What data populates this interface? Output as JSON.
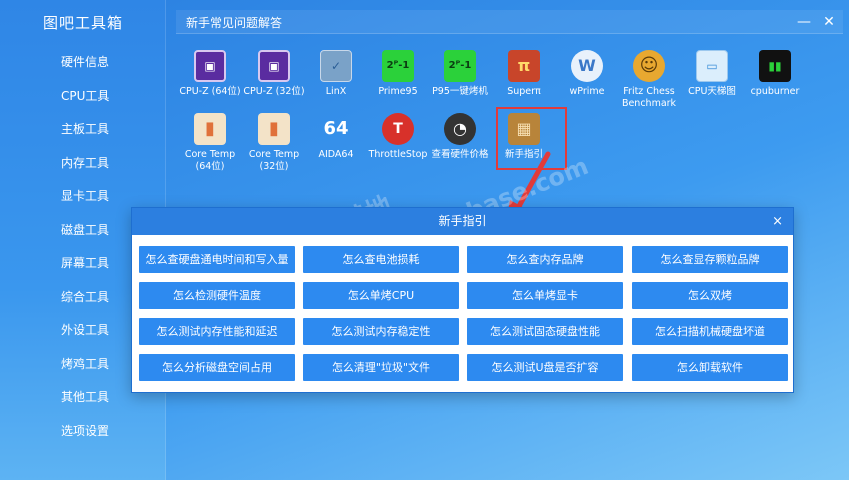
{
  "app": {
    "title": "图吧工具箱"
  },
  "sidebar": {
    "items": [
      {
        "label": "硬件信息"
      },
      {
        "label": "CPU工具"
      },
      {
        "label": "主板工具"
      },
      {
        "label": "内存工具"
      },
      {
        "label": "显卡工具"
      },
      {
        "label": "磁盘工具"
      },
      {
        "label": "屏幕工具"
      },
      {
        "label": "综合工具"
      },
      {
        "label": "外设工具"
      },
      {
        "label": "烤鸡工具"
      },
      {
        "label": "其他工具"
      },
      {
        "label": "选项设置"
      }
    ]
  },
  "topbar": {
    "title": "新手常见问题解答",
    "minimize": "—",
    "close": "✕"
  },
  "tools": [
    {
      "label": "CPU-Z (64位)",
      "icon": "cpu-z-icon",
      "glyph": "▣",
      "color": "#5a2ca0"
    },
    {
      "label": "CPU-Z (32位)",
      "icon": "cpu-z-icon",
      "glyph": "▣",
      "color": "#5a2ca0"
    },
    {
      "label": "LinX",
      "icon": "checkbox-icon",
      "glyph": "✓",
      "color": "#7aa2c8"
    },
    {
      "label": "Prime95",
      "icon": "prime95-icon",
      "glyph": "2ᴾ-1",
      "color": "#2bd13a"
    },
    {
      "label": "P95一键烤机",
      "icon": "prime95-icon",
      "glyph": "2ᴾ-1",
      "color": "#2bd13a"
    },
    {
      "label": "Superπ",
      "icon": "superpi-icon",
      "glyph": "π",
      "color": "#c8452a"
    },
    {
      "label": "wPrime",
      "icon": "wprime-icon",
      "glyph": "W",
      "color": "#3b78c8"
    },
    {
      "label": "Fritz Chess Benchmark",
      "icon": "fritz-icon",
      "glyph": "☺",
      "color": "#e8a830"
    },
    {
      "label": "CPU天梯图",
      "icon": "image-icon",
      "glyph": "▭",
      "color": "#3a8ed8"
    },
    {
      "label": "cpuburner",
      "icon": "cpuburner-icon",
      "glyph": "▮▮",
      "color": "#111111"
    },
    {
      "label": "Core Temp (64位)",
      "icon": "thermometer-icon",
      "glyph": "▮",
      "color": "#e0713a"
    },
    {
      "label": "Core Temp (32位)",
      "icon": "thermometer-icon",
      "glyph": "▮",
      "color": "#e0713a"
    },
    {
      "label": "AIDA64",
      "icon": "aida64-icon",
      "glyph": "64",
      "color": "#1f5fbf"
    },
    {
      "label": "ThrottleStop",
      "icon": "throttlestop-icon",
      "glyph": "T",
      "color": "#d8312a"
    },
    {
      "label": "查看硬件价格",
      "icon": "gauge-icon",
      "glyph": "◔",
      "color": "#333333"
    },
    {
      "label": "新手指引",
      "icon": "box-icon",
      "glyph": "▦",
      "color": "#b8843a"
    }
  ],
  "dialog": {
    "title": "新手指引",
    "close": "×",
    "questions": [
      "怎么查硬盘通电时间和写入量",
      "怎么查电池损耗",
      "怎么查内存品牌",
      "怎么查显存颗粒品牌",
      "怎么检测硬件温度",
      "怎么单烤CPU",
      "怎么单烤显卡",
      "怎么双烤",
      "怎么测试内存性能和延迟",
      "怎么测试内存稳定性",
      "怎么测试固态硬盘性能",
      "怎么扫描机械硬盘坏道",
      "怎么分析磁盘空间占用",
      "怎么清理\"垃圾\"文件",
      "怎么测试U盘是否扩容",
      "怎么卸载软件"
    ]
  },
  "watermark": {
    "line1": "图吧论坛·黑域基地",
    "line2": "www.hybase.com"
  },
  "colors": {
    "accent": "#2d8af0",
    "highlight": "#e13b3b",
    "dialog_header": "#2c7fe0"
  }
}
